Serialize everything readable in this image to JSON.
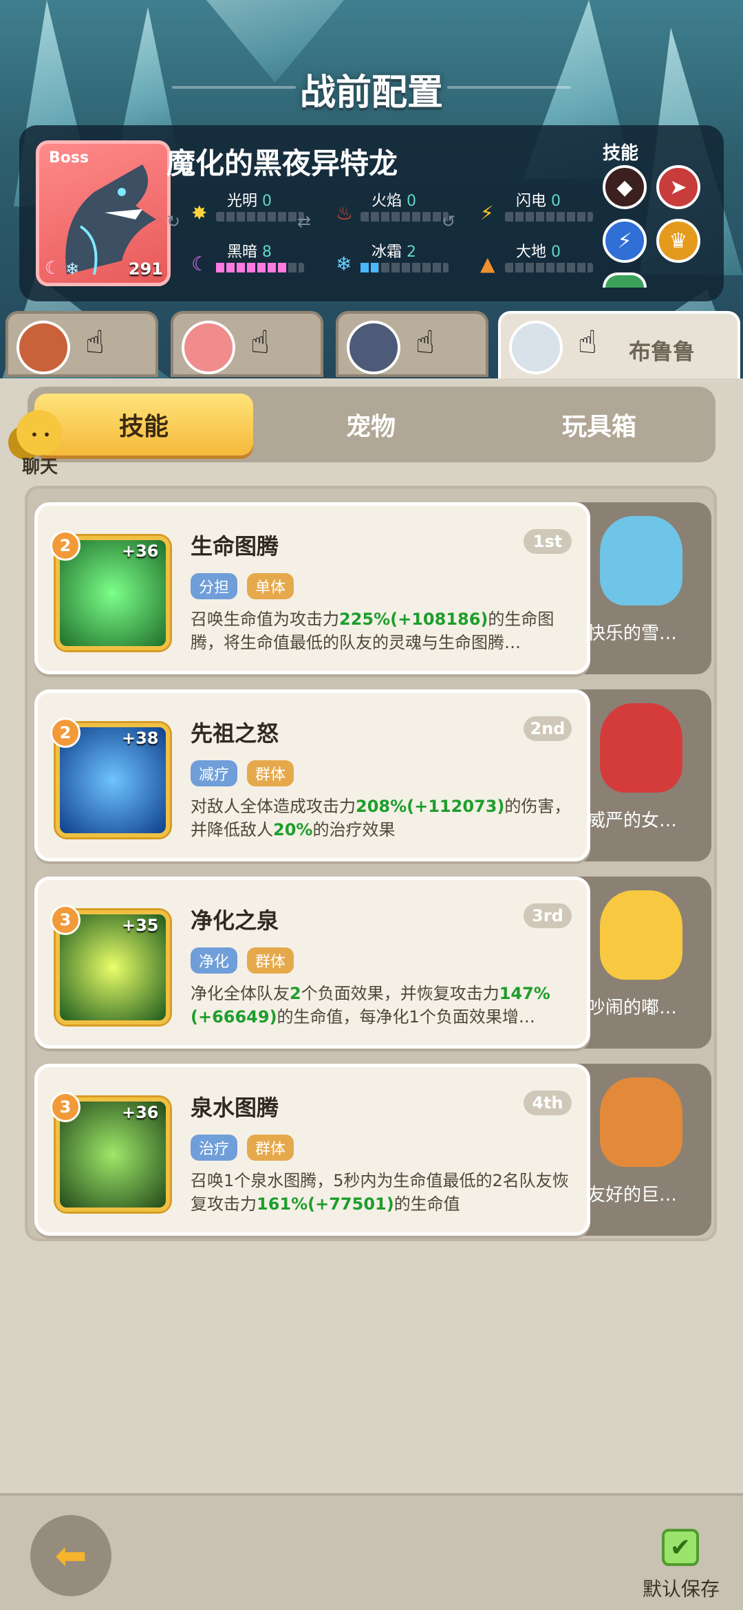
{
  "screen": {
    "title": "战前配置"
  },
  "boss": {
    "tag": "Boss",
    "name": "魔化的黑夜异特龙",
    "level": "291",
    "skills_label": "技能",
    "elements": [
      {
        "name": "光明",
        "value": "0",
        "fill": 0,
        "icon": "sun-icon"
      },
      {
        "name": "火焰",
        "value": "0",
        "fill": 0,
        "icon": "fire-icon"
      },
      {
        "name": "闪电",
        "value": "0",
        "fill": 0,
        "icon": "lightning-icon"
      },
      {
        "name": "黑暗",
        "value": "8",
        "fill": 0.8,
        "icon": "moon-icon"
      },
      {
        "name": "冰霜",
        "value": "2",
        "fill": 0.2,
        "icon": "snowflake-icon"
      },
      {
        "name": "大地",
        "value": "0",
        "fill": 0,
        "icon": "earth-icon"
      }
    ]
  },
  "heroes": [
    {
      "name": "",
      "active": false
    },
    {
      "name": "",
      "active": false
    },
    {
      "name": "",
      "active": false
    },
    {
      "name": "布鲁鲁",
      "active": true
    }
  ],
  "tabs": [
    {
      "label": "技能",
      "active": true
    },
    {
      "label": "宠物",
      "active": false
    },
    {
      "label": "玩具箱",
      "active": false
    }
  ],
  "chat": {
    "label": "聊天"
  },
  "skills": [
    {
      "title": "生命图腾",
      "rank": "1st",
      "level": "2",
      "bonus": "+36",
      "tags": [
        "分担",
        "单体"
      ],
      "desc_parts": [
        {
          "t": "召唤生命值为攻击力"
        },
        {
          "t": "225%(+108186)",
          "g": true
        },
        {
          "t": "的生命图腾，将生命值最低的队友的灵魂与生命图腾…"
        }
      ],
      "pet": "快乐的雪…",
      "color": "#2fae4b"
    },
    {
      "title": "先祖之怒",
      "rank": "2nd",
      "level": "2",
      "bonus": "+38",
      "tags": [
        "减疗",
        "群体"
      ],
      "desc_parts": [
        {
          "t": "对敌人全体造成攻击力"
        },
        {
          "t": "208%(+112073)",
          "g": true
        },
        {
          "t": "的伤害，并降低敌人"
        },
        {
          "t": "20%",
          "g": true
        },
        {
          "t": "的治疗效果"
        }
      ],
      "pet": "威严的女…",
      "color": "#2d74c9"
    },
    {
      "title": "净化之泉",
      "rank": "3rd",
      "level": "3",
      "bonus": "+35",
      "tags": [
        "净化",
        "群体"
      ],
      "desc_parts": [
        {
          "t": "净化全体队友"
        },
        {
          "t": "2",
          "g": true
        },
        {
          "t": "个负面效果，并恢复攻击力"
        },
        {
          "t": "147%(+66649)",
          "g": true
        },
        {
          "t": "的生命值，每净化1个负面效果增…"
        }
      ],
      "pet": "吵闹的嘟…",
      "color": "#4d9a22"
    },
    {
      "title": "泉水图腾",
      "rank": "4th",
      "level": "3",
      "bonus": "+36",
      "tags": [
        "治疗",
        "群体"
      ],
      "desc_parts": [
        {
          "t": "召唤1个泉水图腾，5秒内为生命值最低的2名队友恢复攻击力"
        },
        {
          "t": "161%(+77501)",
          "g": true
        },
        {
          "t": "的生命值"
        }
      ],
      "pet": "友好的巨…",
      "color": "#3f8f2a"
    }
  ],
  "footer": {
    "save_label": "默认保存"
  }
}
